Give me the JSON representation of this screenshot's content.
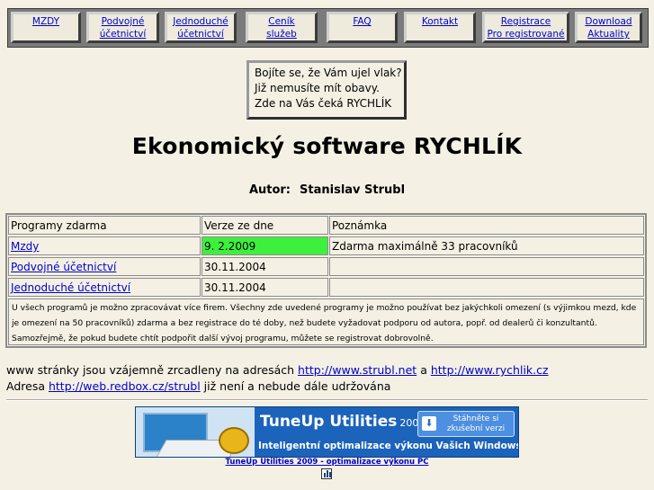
{
  "nav": {
    "items": [
      {
        "line1": "MZDY",
        "line2": ""
      },
      {
        "line1": "Podvojné",
        "line2": "účetnictví"
      },
      {
        "line1": "Jednoduché",
        "line2": "účetnictví"
      },
      {
        "line1": "Ceník",
        "line2": "služeb"
      },
      {
        "line1": "FAQ",
        "line2": ""
      },
      {
        "line1": "Kontakt",
        "line2": ""
      },
      {
        "line1": "Registrace",
        "line2": "Pro registrované"
      },
      {
        "line1": "Download",
        "line2": "Aktuality"
      }
    ]
  },
  "teaser": {
    "line1": "Bojíte se, že Vám ujel vlak?",
    "line2": "Již nemusíte mít obavy.",
    "line3": "Zde na Vás čeká RYCHLÍK"
  },
  "title": "Ekonomický software RYCHLÍK",
  "author": {
    "label": "Autor:",
    "name": "Stanislav Strubl"
  },
  "table": {
    "headers": [
      "Programy zdarma",
      "Verze ze dne",
      "Poznámka"
    ],
    "rows": [
      {
        "program": "Mzdy",
        "version": "9. 2.2009",
        "note": "Zdarma maximálně 33 pracovníků"
      },
      {
        "program": "Podvojné účetnictví",
        "version": "30.11.2004",
        "note": ""
      },
      {
        "program": "Jednoduché účetnictví",
        "version": "30.11.2004",
        "note": ""
      }
    ],
    "notice": "U všech programů je možno zpracovávat více firem. Všechny zde uvedené programy je možno používat bez jakýchkoli omezení (s výjimkou mezd, kde je omezení na 50 pracovníků) zdarma a bez registrace do té doby, než budete vyžadovat podporu od autora, popř. od dealerů či konzultantů. Samozřejmě, že pokud budete chtít podpořit další vývoj programu, můžete se registrovat dobrovolně.",
    "highlight_color": "#3cf03c"
  },
  "mirrors": {
    "text_before": "www stránky jsou vzájemně zrcadleny na adresách",
    "link1": "http://www.strubl.net",
    "conj": "a",
    "link2": "http://www.rychlik.cz"
  },
  "old_address": {
    "text_before": "Adresa",
    "link": "http://web.redbox.cz/strubl",
    "text_after": "již není a nebude dále udržována"
  },
  "banner": {
    "brand": "TuneUp Utilities",
    "year": "2009",
    "cta_line1": "Stáhněte si",
    "cta_line2": "zkušební verzi",
    "cta_arrow": "⬇",
    "subtitle": "Inteligentní optimalizace výkonu Vašich Windows",
    "link": "TuneUp Utilities 2009 - optimalizace výkonu PC",
    "background": "#1b63bb"
  }
}
